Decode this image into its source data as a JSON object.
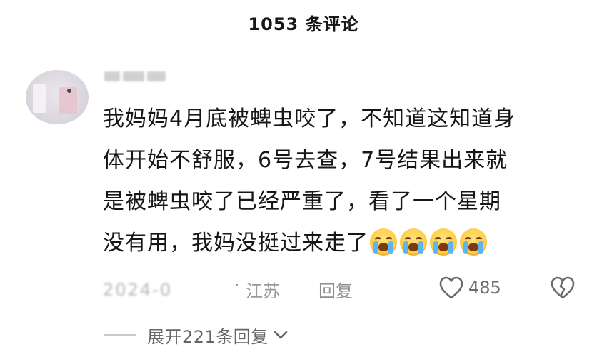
{
  "header": {
    "title": "1053 条评论"
  },
  "comment": {
    "lines": [
      "我妈妈4月底被蜱虫咬了，不知道这知道身",
      "体开始不舒服，6号去查，7号结果出来就",
      "是被蜱虫咬了已经严重了，看了一个星期",
      "没有用，我妈没挺过来走了"
    ],
    "emojis": [
      "crying-face-icon",
      "crying-face-icon",
      "crying-face-icon",
      "crying-face-icon"
    ],
    "meta": {
      "date_blurred": "2024-0",
      "separator": "·",
      "region": "江苏",
      "reply_label": "回复",
      "like_count": "485"
    }
  },
  "replies": {
    "expand_label": "展开221条回复"
  },
  "colors": {
    "text_primary": "#161616",
    "text_meta": "#9a9a9a",
    "emoji_yellow": "#ffc93d",
    "tear_blue": "#5fb4f2"
  }
}
